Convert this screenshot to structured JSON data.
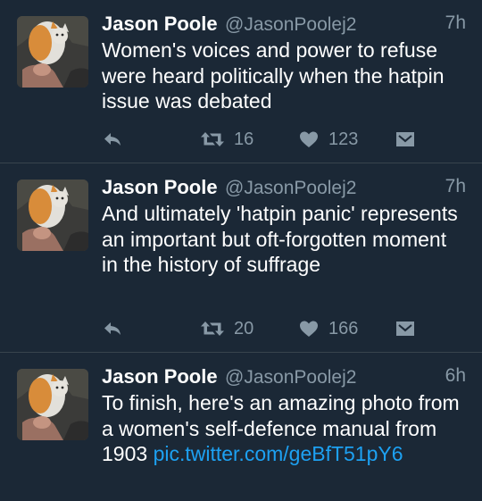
{
  "tweets": [
    {
      "name": "Jason Poole",
      "handle": "@JasonPoolej2",
      "time": "7h",
      "text": "Women's voices and power to refuse were heard politically when the hatpin issue was debated",
      "retweets": "16",
      "likes": "123"
    },
    {
      "name": "Jason Poole",
      "handle": "@JasonPoolej2",
      "time": "7h",
      "text": "And ultimately 'hatpin panic' represents an important but oft-forgotten moment in the history of suffrage",
      "retweets": "20",
      "likes": "166"
    },
    {
      "name": "Jason Poole",
      "handle": "@JasonPoolej2",
      "time": "6h",
      "text": "To finish, here's an amazing photo from a women's self-defence manual from 1903",
      "link": "pic.twitter.com/geBfT51pY6"
    }
  ],
  "icons": {
    "reply": "reply-icon",
    "retweet": "retweet-icon",
    "like": "heart-icon",
    "dm": "direct-message-icon"
  },
  "colors": {
    "background": "#1b2836",
    "text": "#ffffff",
    "secondary": "#8899a6",
    "link": "#1da1f2",
    "divider": "#38444d"
  }
}
